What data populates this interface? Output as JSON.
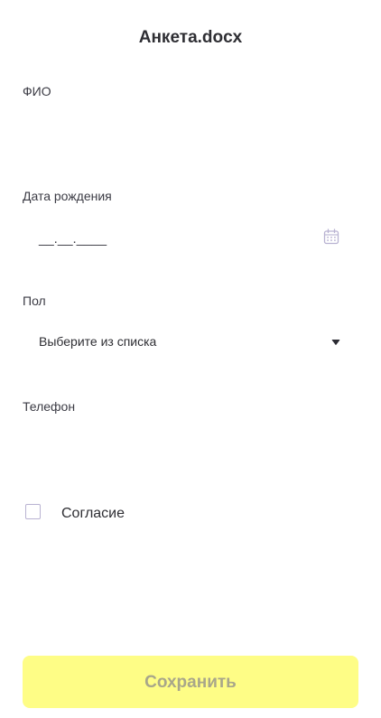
{
  "header": {
    "title": "Анкета.docx"
  },
  "form": {
    "full_name": {
      "label": "ФИО",
      "value": ""
    },
    "birth_date": {
      "label": "Дата рождения",
      "value": "__.__.____",
      "icon": "calendar-icon"
    },
    "gender": {
      "label": "Пол",
      "selected": "Выберите из списка",
      "icon": "chevron-down-icon"
    },
    "phone": {
      "label": "Телефон",
      "value": ""
    },
    "consent": {
      "label": "Согласие",
      "checked": false
    }
  },
  "actions": {
    "save_label": "Сохранить"
  },
  "colors": {
    "button_bg": "#fefd86",
    "button_text": "#a8a68a",
    "icon_accent": "#b9b3d2"
  }
}
